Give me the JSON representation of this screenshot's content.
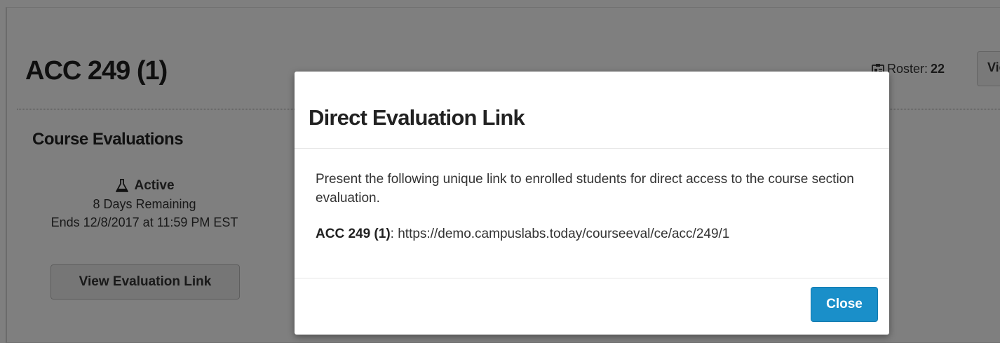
{
  "course": {
    "title": "ACC 249 (1)",
    "roster_label": "Roster:",
    "roster_count": "22",
    "view_roster_label": "View",
    "roster_icon": "roster-card-icon"
  },
  "evaluations": {
    "heading": "Course Evaluations",
    "status": "Active",
    "status_icon": "flask-icon",
    "remaining": "8 Days Remaining",
    "ends": "Ends 12/8/2017 at 11:59 PM EST",
    "view_link_label": "View Evaluation Link"
  },
  "modal": {
    "title": "Direct Evaluation Link",
    "description": "Present the following unique link to enrolled students for direct access to the course section evaluation.",
    "link_label": "ACC 249 (1)",
    "link_separator": ": ",
    "link_url": "https://demo.campuslabs.today/courseeval/ce/acc/249/1",
    "close_label": "Close"
  },
  "colors": {
    "primary": "#1a8fc9",
    "overlay": "rgba(0,0,0,0.5)"
  }
}
